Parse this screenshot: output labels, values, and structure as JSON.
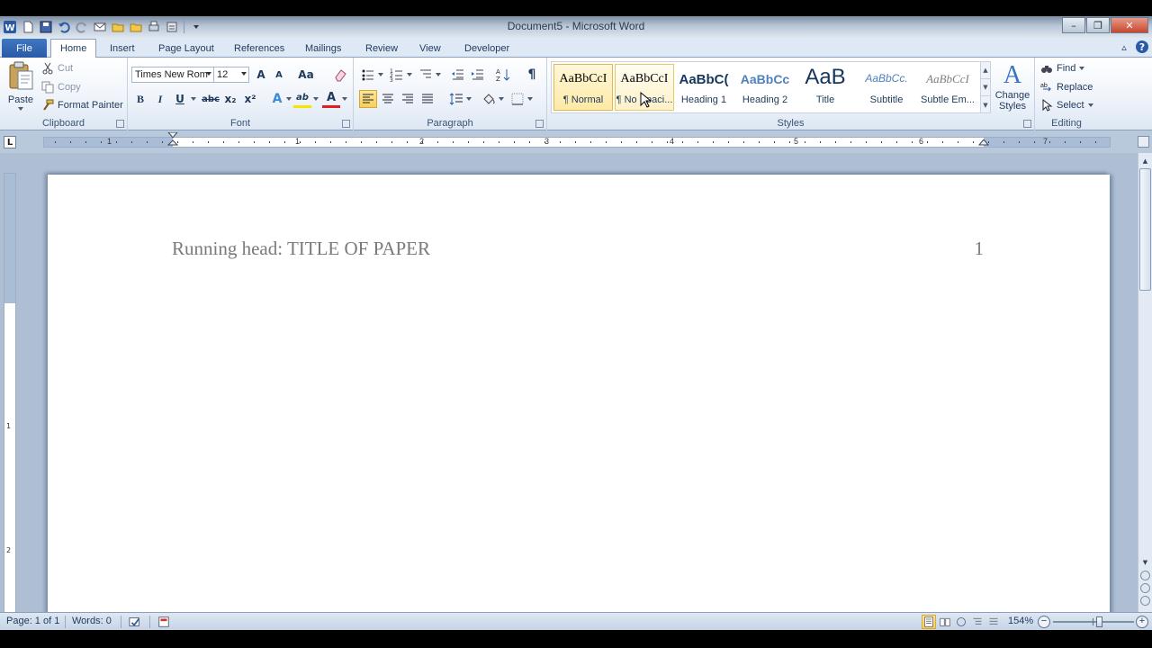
{
  "window": {
    "title": "Document5 - Microsoft Word",
    "minimize_glyph": "–",
    "restore_glyph": "❐",
    "close_glyph": "✕"
  },
  "tabs": [
    "File",
    "Home",
    "Insert",
    "Page Layout",
    "References",
    "Mailings",
    "Review",
    "View",
    "Developer"
  ],
  "active_tab": "Home",
  "tab_right": {
    "collapse_glyph": "▵",
    "help_glyph": "?"
  },
  "clipboard": {
    "paste_label": "Paste",
    "cut_label": "Cut",
    "copy_label": "Copy",
    "format_painter_label": "Format Painter",
    "group_label": "Clipboard"
  },
  "font": {
    "font_name": "Times New Rom",
    "font_size": "12",
    "grow_glyph": "A",
    "shrink_glyph": "A",
    "change_case_glyph": "Aa",
    "bold_glyph": "B",
    "italic_glyph": "I",
    "underline_glyph": "U",
    "strike_glyph": "abc",
    "subscript_glyph": "x₂",
    "superscript_glyph": "x²",
    "effects_glyph": "A",
    "highlight_glyph": "ab",
    "font_color_glyph": "A",
    "group_label": "Font"
  },
  "paragraph": {
    "pilcrow_glyph": "¶",
    "group_label": "Paragraph"
  },
  "styles": {
    "items": [
      {
        "sample": "AaBbCcI",
        "name": "¶ Normal"
      },
      {
        "sample": "AaBbCcI",
        "name": "¶ No Spaci..."
      },
      {
        "sample": "AaBbC(",
        "name": "Heading 1"
      },
      {
        "sample": "AaBbCc",
        "name": "Heading 2"
      },
      {
        "sample": "AaB",
        "name": "Title"
      },
      {
        "sample": "AaBbCc.",
        "name": "Subtitle"
      },
      {
        "sample": "AaBbCcI",
        "name": "Subtle Em..."
      }
    ],
    "change_styles_label": "Change Styles",
    "change_styles_glyph": "A",
    "group_label": "Styles"
  },
  "editing": {
    "find_label": "Find",
    "replace_label": "Replace",
    "select_label": "Select",
    "group_label": "Editing"
  },
  "ruler": {
    "corner_glyph": "L",
    "numbers": [
      "1",
      "1",
      "2",
      "3",
      "4",
      "5",
      "6",
      "7"
    ]
  },
  "vruler": {
    "numbers": [
      "1",
      "2"
    ]
  },
  "document": {
    "running_head": "Running head: TITLE OF PAPER",
    "page_number": "1"
  },
  "status": {
    "page": "Page: 1 of 1",
    "words": "Words: 0",
    "zoom": "154%",
    "zoom_out_glyph": "−",
    "zoom_in_glyph": "+"
  }
}
